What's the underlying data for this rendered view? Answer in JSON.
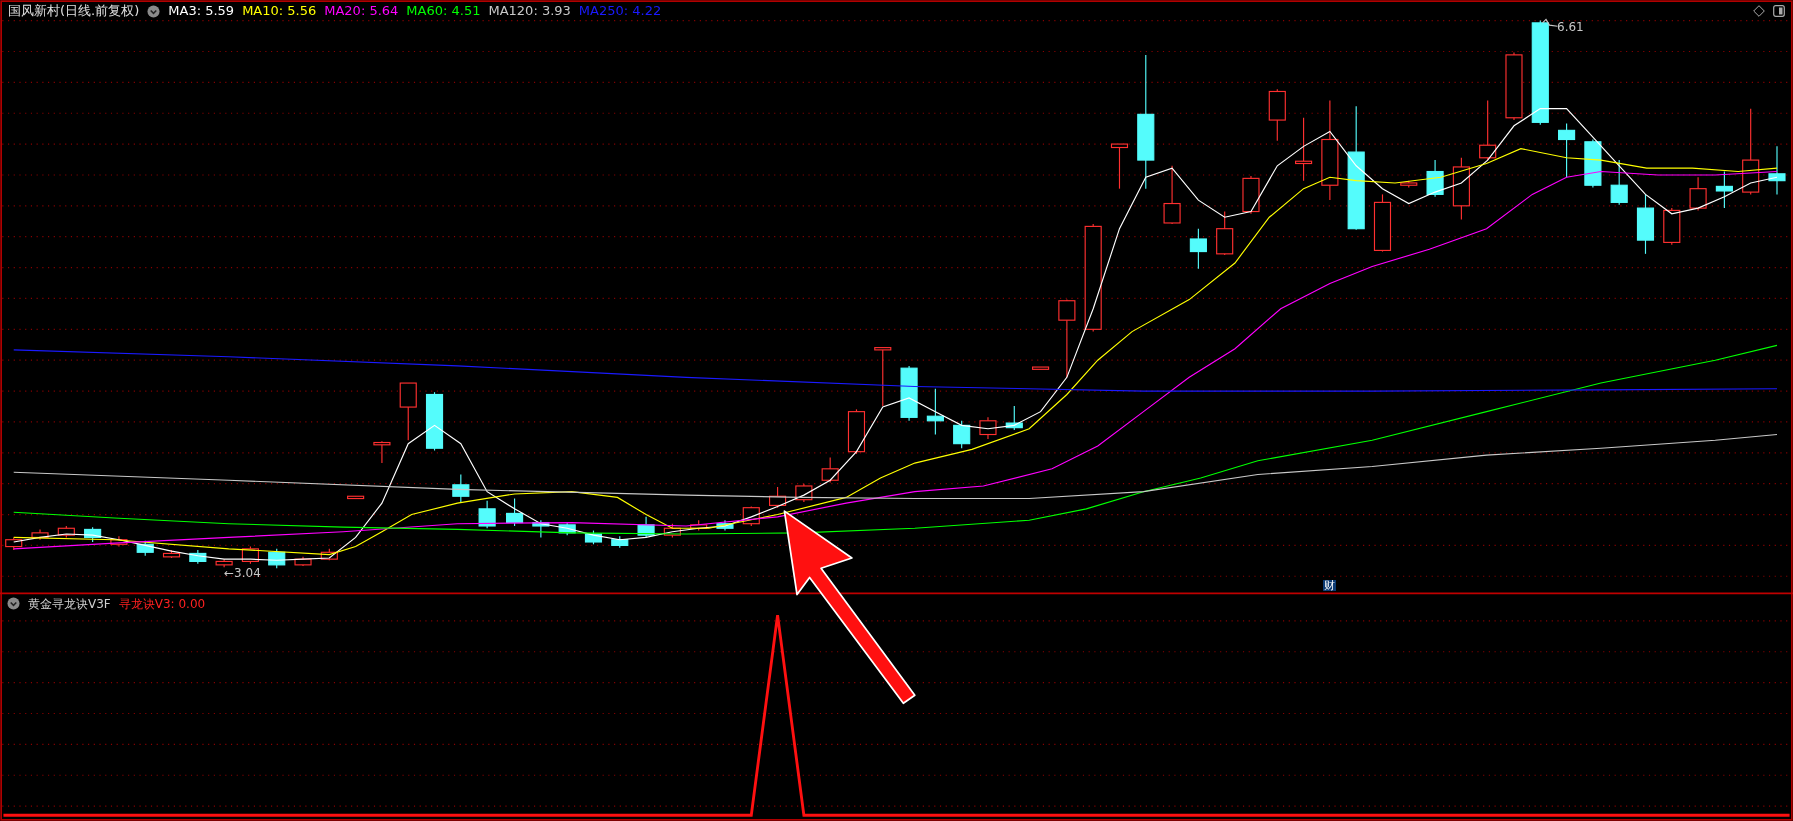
{
  "chart": {
    "title": "国风新村(日线.前复权)",
    "indicators": [
      {
        "label": "MA3: 5.59",
        "color": "#ffffff"
      },
      {
        "label": "MA10: 5.56",
        "color": "#ffff00"
      },
      {
        "label": "MA20: 5.64",
        "color": "#ff00ff"
      },
      {
        "label": "MA60: 4.51",
        "color": "#00ff00"
      },
      {
        "label": "MA120: 3.93",
        "color": "#c8c8c8"
      },
      {
        "label": "MA250: 4.22",
        "color": "#1a1aff"
      }
    ],
    "high_label": "6.61",
    "low_label": "←3.04",
    "marker": "财"
  },
  "indicator_panel": {
    "title": "黄金寻龙诀V3F",
    "value": "寻龙诀V3: 0.00"
  }
}
